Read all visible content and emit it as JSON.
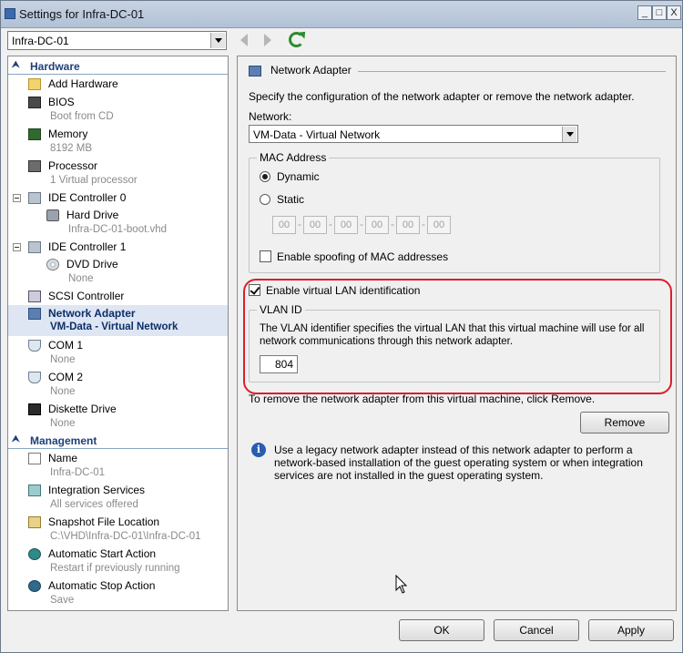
{
  "window": {
    "title": "Settings for Infra-DC-01"
  },
  "vm_selector": {
    "value": "Infra-DC-01"
  },
  "sidebar": {
    "hardware_header": "Hardware",
    "management_header": "Management",
    "items": [
      {
        "label": "Add Hardware",
        "sub": ""
      },
      {
        "label": "BIOS",
        "sub": "Boot from CD"
      },
      {
        "label": "Memory",
        "sub": "8192 MB"
      },
      {
        "label": "Processor",
        "sub": "1 Virtual processor"
      },
      {
        "label": "IDE Controller 0",
        "sub": ""
      },
      {
        "label": "Hard Drive",
        "sub": "Infra-DC-01-boot.vhd"
      },
      {
        "label": "IDE Controller 1",
        "sub": ""
      },
      {
        "label": "DVD Drive",
        "sub": "None"
      },
      {
        "label": "SCSI Controller",
        "sub": ""
      },
      {
        "label": "Network Adapter",
        "sub": "VM-Data - Virtual Network"
      },
      {
        "label": "COM 1",
        "sub": "None"
      },
      {
        "label": "COM 2",
        "sub": "None"
      },
      {
        "label": "Diskette Drive",
        "sub": "None"
      }
    ],
    "mgmt_items": [
      {
        "label": "Name",
        "sub": "Infra-DC-01"
      },
      {
        "label": "Integration Services",
        "sub": "All services offered"
      },
      {
        "label": "Snapshot File Location",
        "sub": "C:\\VHD\\Infra-DC-01\\Infra-DC-01"
      },
      {
        "label": "Automatic Start Action",
        "sub": "Restart if previously running"
      },
      {
        "label": "Automatic Stop Action",
        "sub": "Save"
      }
    ]
  },
  "panel": {
    "title": "Network Adapter",
    "description": "Specify the configuration of the network adapter or remove the network adapter.",
    "network_label": "Network:",
    "network_value": "VM-Data - Virtual Network",
    "mac_group": "MAC Address",
    "dynamic_label": "Dynamic",
    "static_label": "Static",
    "mac_octets": [
      "00",
      "00",
      "00",
      "00",
      "00",
      "00"
    ],
    "spoofing_label": "Enable spoofing of MAC addresses",
    "vlan_enable_label": "Enable virtual LAN identification",
    "vlan_group": "VLAN ID",
    "vlan_desc_1": "The VLAN identifier specifies the virtual LAN that this virtual machine will use for all",
    "vlan_desc_2": "network communications through this network adapter.",
    "vlan_value": "804",
    "remove_hint": "To remove the network adapter from this virtual machine, click Remove.",
    "remove_button": "Remove",
    "legacy_1": "Use a legacy network adapter instead of this network adapter to perform a",
    "legacy_2": "network-based installation of the guest operating system or when integration",
    "legacy_3": "services are not installed in the guest operating system."
  },
  "footer": {
    "ok": "OK",
    "cancel": "Cancel",
    "apply": "Apply"
  },
  "window_controls": {
    "minimize": "_",
    "maximize": "□",
    "close": "X"
  }
}
